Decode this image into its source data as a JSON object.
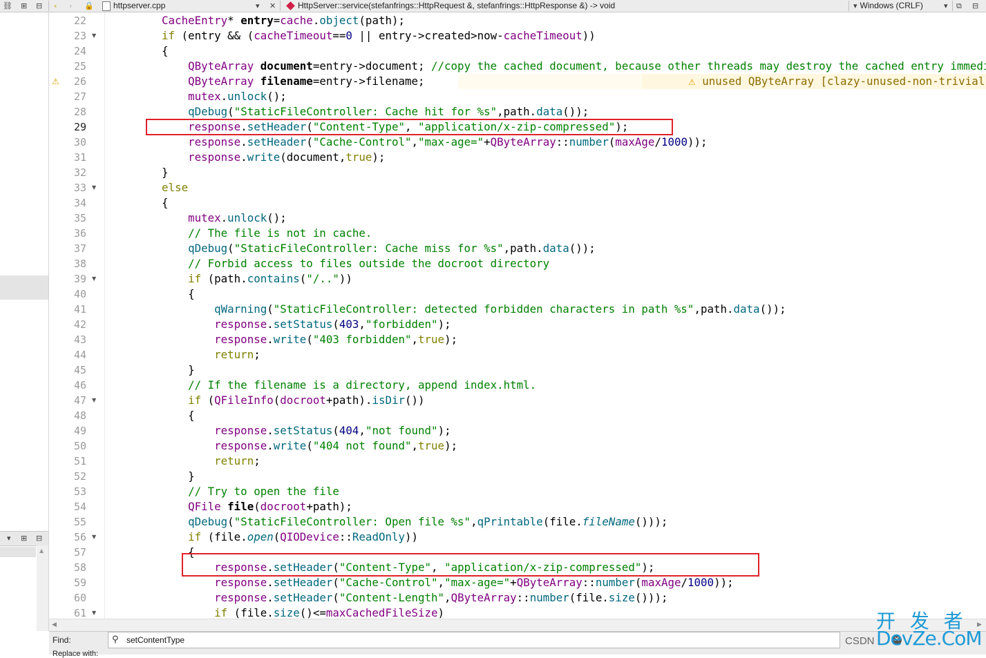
{
  "toolbar": {
    "file_name": "httpserver.cpp",
    "function_signature": "HttpServer::service(stefanfrings::HttpRequest &, stefanfrings::HttpResponse &) -> void",
    "line_endings": "Windows (CRLF)",
    "icons": [
      "link-icon",
      "split-icon",
      "close-panel-icon",
      "back-icon",
      "forward-icon",
      "lock-icon",
      "file-icon",
      "dropdown-icon",
      "close-icon",
      "function-icon",
      "split-window-icon",
      "close-window-icon"
    ]
  },
  "editor": {
    "current_line": 29,
    "lines": [
      {
        "n": 22,
        "code": "    CacheEntry* entry=cache.object(path);"
      },
      {
        "n": 23,
        "code": "    if (entry && (cacheTimeout==0 || entry->created>now-cacheTimeout))",
        "fold": true
      },
      {
        "n": 24,
        "code": "    {"
      },
      {
        "n": 25,
        "code": "        QByteArray document=entry->document; //copy the cached document, because other threads may destroy the cached entry immediately after mutex unlock."
      },
      {
        "n": 26,
        "code": "        QByteArray filename=entry->filename;",
        "warning": "unused QByteArray [clazy-unused-non-trivial-variable]"
      },
      {
        "n": 27,
        "code": "        mutex.unlock();"
      },
      {
        "n": 28,
        "code": "        qDebug(\"StaticFileController: Cache hit for %s\",path.data());"
      },
      {
        "n": 29,
        "code": "        response.setHeader(\"Content-Type\", \"application/x-zip-compressed\");"
      },
      {
        "n": 30,
        "code": "        response.setHeader(\"Cache-Control\",\"max-age=\"+QByteArray::number(maxAge/1000));"
      },
      {
        "n": 31,
        "code": "        response.write(document,true);"
      },
      {
        "n": 32,
        "code": "    }"
      },
      {
        "n": 33,
        "code": "    else",
        "fold": true
      },
      {
        "n": 34,
        "code": "    {"
      },
      {
        "n": 35,
        "code": "        mutex.unlock();"
      },
      {
        "n": 36,
        "code": "        // The file is not in cache."
      },
      {
        "n": 37,
        "code": "        qDebug(\"StaticFileController: Cache miss for %s\",path.data());"
      },
      {
        "n": 38,
        "code": "        // Forbid access to files outside the docroot directory"
      },
      {
        "n": 39,
        "code": "        if (path.contains(\"/..\"))",
        "fold": true
      },
      {
        "n": 40,
        "code": "        {"
      },
      {
        "n": 41,
        "code": "            qWarning(\"StaticFileController: detected forbidden characters in path %s\",path.data());"
      },
      {
        "n": 42,
        "code": "            response.setStatus(403,\"forbidden\");"
      },
      {
        "n": 43,
        "code": "            response.write(\"403 forbidden\",true);"
      },
      {
        "n": 44,
        "code": "            return;"
      },
      {
        "n": 45,
        "code": "        }"
      },
      {
        "n": 46,
        "code": "        // If the filename is a directory, append index.html."
      },
      {
        "n": 47,
        "code": "        if (QFileInfo(docroot+path).isDir())",
        "fold": true
      },
      {
        "n": 48,
        "code": "        {"
      },
      {
        "n": 49,
        "code": "            response.setStatus(404,\"not found\");"
      },
      {
        "n": 50,
        "code": "            response.write(\"404 not found\",true);"
      },
      {
        "n": 51,
        "code": "            return;"
      },
      {
        "n": 52,
        "code": "        }"
      },
      {
        "n": 53,
        "code": "        // Try to open the file"
      },
      {
        "n": 54,
        "code": "        QFile file(docroot+path);"
      },
      {
        "n": 55,
        "code": "        qDebug(\"StaticFileController: Open file %s\",qPrintable(file.fileName()));"
      },
      {
        "n": 56,
        "code": "        if (file.open(QIODevice::ReadOnly))",
        "fold": true
      },
      {
        "n": 57,
        "code": "        {"
      },
      {
        "n": 58,
        "code": "            response.setHeader(\"Content-Type\", \"application/x-zip-compressed\");"
      },
      {
        "n": 59,
        "code": "            response.setHeader(\"Cache-Control\",\"max-age=\"+QByteArray::number(maxAge/1000));"
      },
      {
        "n": 60,
        "code": "            response.setHeader(\"Content-Length\",QByteArray::number(file.size()));"
      },
      {
        "n": 61,
        "code": "            if (file.size()<=maxCachedFileSize)",
        "fold": true
      }
    ]
  },
  "find": {
    "label": "Find:",
    "replace_label": "Replace with:",
    "value": "setContentType",
    "overlay_text": "CSDN"
  },
  "watermark": {
    "top": "开 发 者",
    "bottom": "DevZe.CoM"
  },
  "colors": {
    "highlight_box": "#e0202a",
    "keyword": "#808000",
    "string": "#008000",
    "type": "#800080",
    "function": "#00677c",
    "number": "#000080"
  }
}
